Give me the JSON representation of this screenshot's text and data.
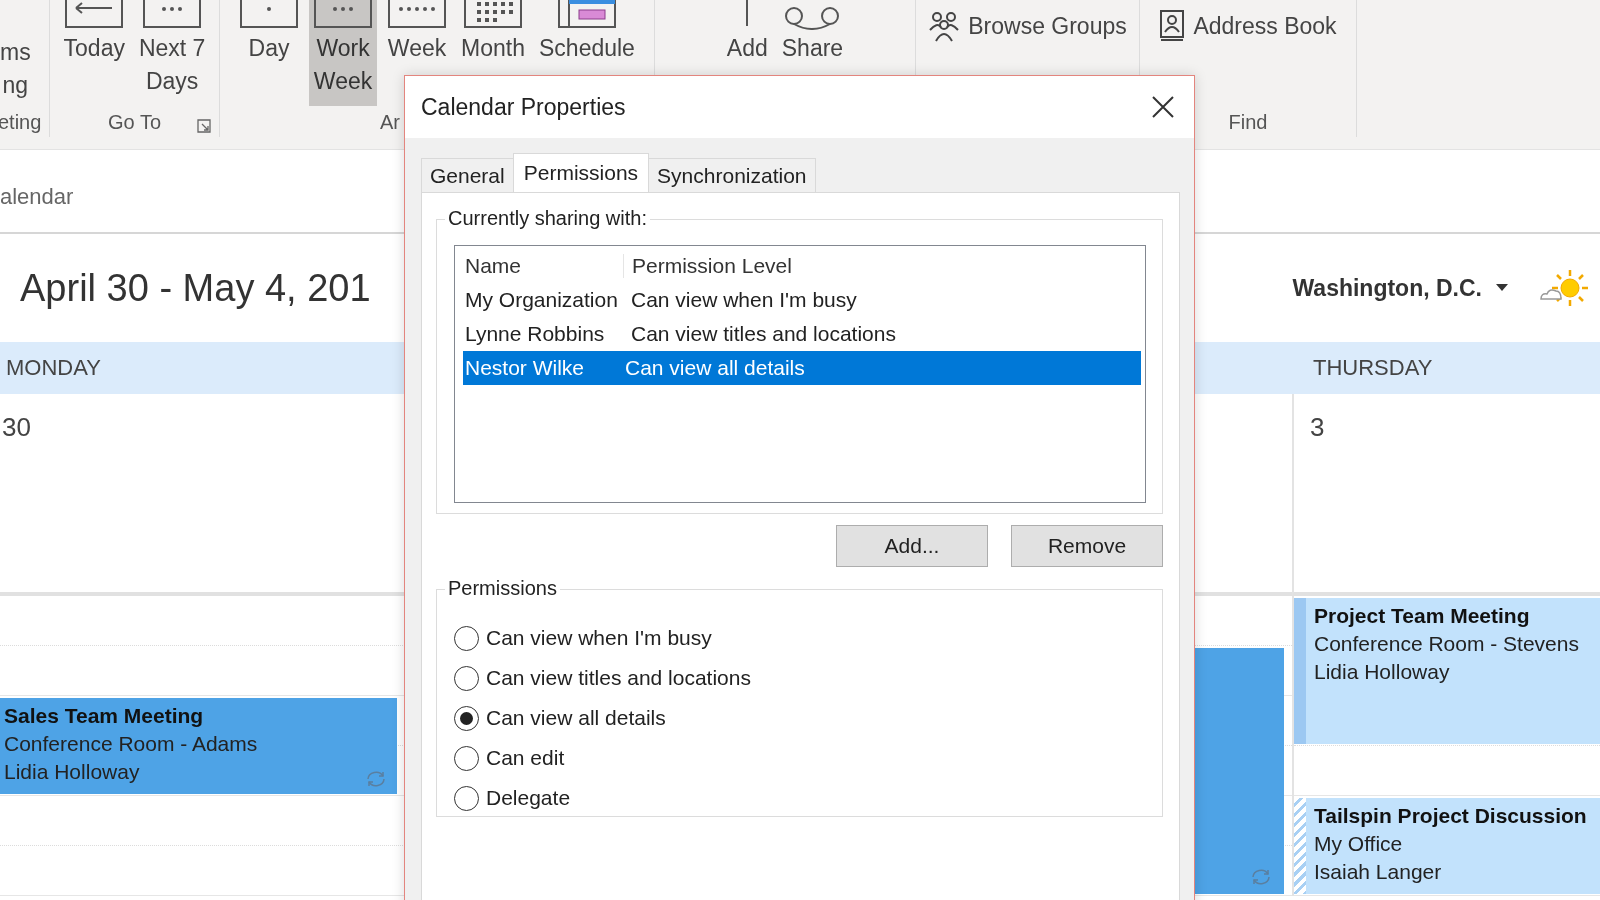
{
  "ribbon": {
    "groups": [
      {
        "label": "eting",
        "buttons": [
          {
            "lines": [
              "ms",
              "ng"
            ],
            "kind": "none",
            "selected": false
          }
        ]
      },
      {
        "label": "Go To",
        "launcher": true,
        "buttons": [
          {
            "lines": [
              "Today"
            ],
            "kind": "today",
            "selected": false
          },
          {
            "lines": [
              "Next 7",
              "Days"
            ],
            "kind": "next7",
            "selected": false
          }
        ]
      },
      {
        "label": "Ar",
        "buttons": [
          {
            "lines": [
              "Day"
            ],
            "kind": "day",
            "selected": false
          },
          {
            "lines": [
              "Work",
              "Week"
            ],
            "kind": "workweek",
            "selected": true
          },
          {
            "lines": [
              "Week"
            ],
            "kind": "week",
            "selected": false
          },
          {
            "lines": [
              "Month"
            ],
            "kind": "month",
            "selected": false
          },
          {
            "lines": [
              "Schedule"
            ],
            "kind": "schedule",
            "selected": false
          }
        ]
      },
      {
        "buttons": [
          {
            "lines": [
              "Add"
            ],
            "kind": "add",
            "selected": false
          },
          {
            "lines": [
              "Share"
            ],
            "kind": "share",
            "selected": false
          }
        ]
      },
      {
        "buttons": [
          {
            "lines": [
              "Browse Groups"
            ],
            "kind": "groups"
          }
        ]
      },
      {
        "label": "Find",
        "buttons": [
          {
            "lines": [
              "Address Book"
            ],
            "kind": "addressbook"
          }
        ]
      }
    ]
  },
  "calendar": {
    "breadcrumb": "alendar",
    "date_range": "April 30 - May 4, 201",
    "location": "Washington, D.C.",
    "days": [
      {
        "name": "MONDAY",
        "number": "30",
        "events": [
          {
            "title": "Sales Team Meeting",
            "location": "Conference Room - Adams",
            "organizer": "Lidia Holloway",
            "color": "#4ea3e6",
            "recurring": true
          }
        ]
      },
      {
        "events": [
          {
            "color": "#4ea3e6",
            "recurring": true
          }
        ]
      },
      {
        "name": "THURSDAY",
        "number": "3",
        "events": [
          {
            "title": "Project Team Meeting",
            "location": "Conference Room - Stevens",
            "organizer": "Lidia Holloway",
            "color": "#c2e2fc",
            "tentative": false,
            "recurring": false
          },
          {
            "title": "Tailspin Project Discussion",
            "location": "My Office",
            "organizer": "Isaiah Langer",
            "color": "#c2e2fc",
            "tentative": true,
            "recurring": false
          }
        ]
      }
    ]
  },
  "dialog": {
    "title": "Calendar Properties",
    "tabs": [
      {
        "label": "General",
        "selected": false
      },
      {
        "label": "Permissions",
        "selected": true
      },
      {
        "label": "Synchronization",
        "selected": false
      }
    ],
    "sharing": {
      "legend": "Currently sharing with:",
      "columns": [
        "Name",
        "Permission Level"
      ],
      "rows": [
        {
          "cells": [
            "My Organization",
            "Can view when I'm busy"
          ],
          "selected": false
        },
        {
          "cells": [
            "Lynne Robbins",
            "Can view titles and locations"
          ],
          "selected": false
        },
        {
          "cells": [
            "Nestor Wilke",
            "Can view all details"
          ],
          "selected": true
        }
      ]
    },
    "buttons": [
      "Add...",
      "Remove"
    ],
    "permissions": {
      "legend": "Permissions",
      "options": [
        {
          "label": "Can view when I'm busy",
          "selected": false
        },
        {
          "label": "Can view titles and locations",
          "selected": false
        },
        {
          "label": "Can view all details",
          "selected": true
        },
        {
          "label": "Can edit",
          "selected": false
        },
        {
          "label": "Delegate",
          "selected": false
        }
      ]
    }
  }
}
